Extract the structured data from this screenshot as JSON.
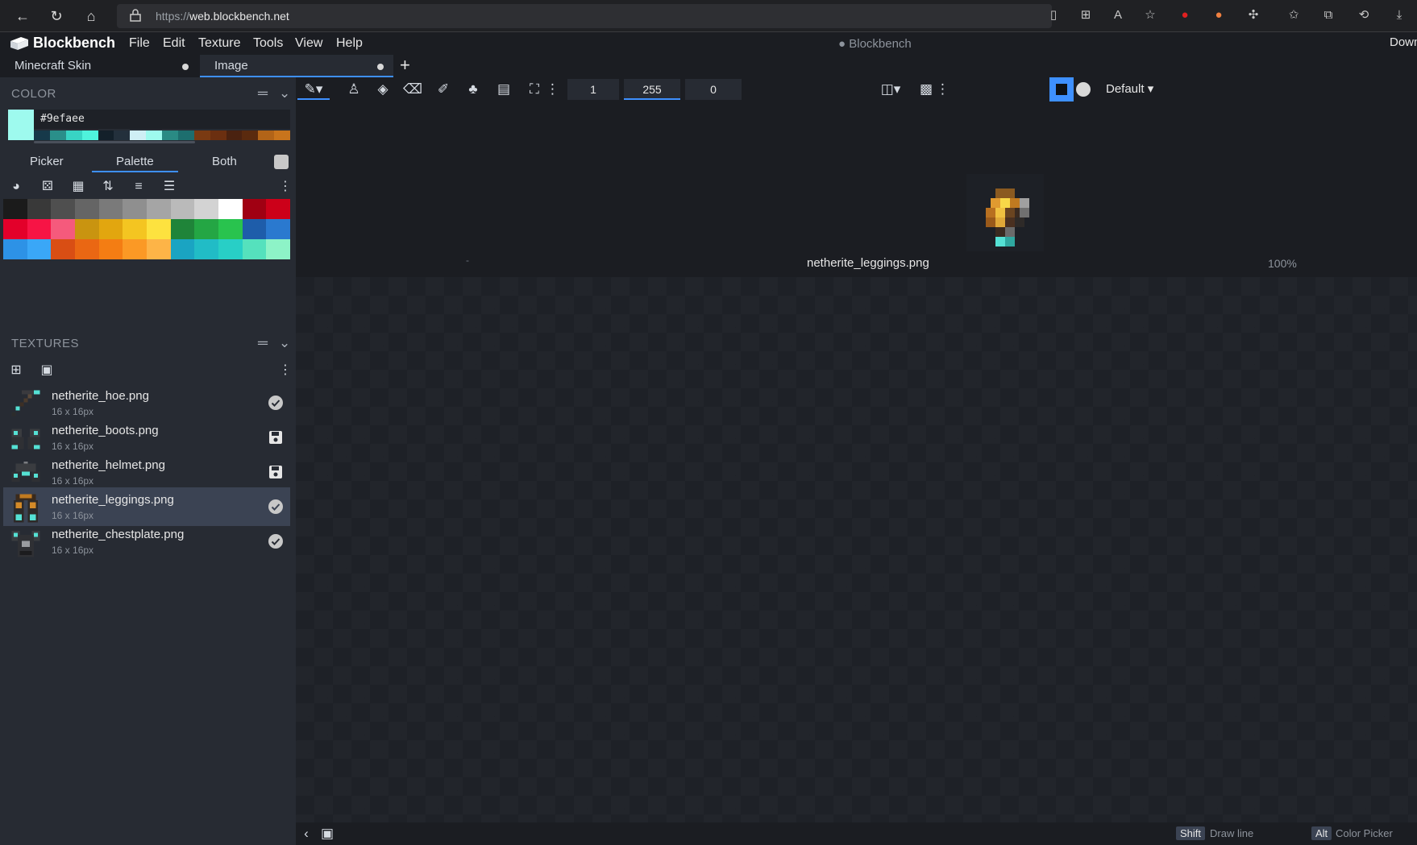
{
  "browser": {
    "url_protocol": "https://",
    "url_host": "web.blockbench.net"
  },
  "app": {
    "name": "Blockbench",
    "menu": [
      "File",
      "Edit",
      "Texture",
      "Tools",
      "View",
      "Help"
    ],
    "window_title": "● Blockbench",
    "download_label": "Down"
  },
  "tabs": [
    {
      "label": "Minecraft Skin"
    },
    {
      "label": "Image"
    }
  ],
  "color_panel": {
    "title": "COLOR",
    "current_hex": "#9efaee",
    "current_color": "#9efaee",
    "history": [
      "#16394a",
      "#2a8f8a",
      "#38d4c4",
      "#4ff2dc",
      "#13202a",
      "#23303c",
      "#cfeff5",
      "#9efaee",
      "#2a8a84",
      "#1d6e6e",
      "#7a3a12",
      "#6b2f10",
      "#4a2210",
      "#5a2a0e",
      "#b26418",
      "#c8741c"
    ],
    "tabs": {
      "picker": "Picker",
      "palette": "Palette",
      "both": "Both"
    },
    "palette": [
      "#1b1b1b",
      "#393939",
      "#4f4f4f",
      "#656565",
      "#7a7a7a",
      "#8f8f8f",
      "#a5a5a5",
      "#bababa",
      "#d3d3d3",
      "#ffffff",
      "#a00012",
      "#cc0019",
      "#e3002a",
      "#f71445",
      "#f55a7c",
      "#c99410",
      "#e2a60f",
      "#f4c521",
      "#fde23f",
      "#1f8439",
      "#24a644",
      "#29c34e",
      "#1e5daa",
      "#2a79cf",
      "#2d92e6",
      "#3aa7f7",
      "#d94e14",
      "#ea6713",
      "#f47d13",
      "#fb9925",
      "#fdb447",
      "#1aa4c2",
      "#21bcc6",
      "#28cfc6",
      "#55e1bd",
      "#8df3c7"
    ]
  },
  "textures_panel": {
    "title": "TEXTURES",
    "items": [
      {
        "name": "netherite_hoe.png",
        "size": "16 x 16px",
        "status": "check-circle-icon"
      },
      {
        "name": "netherite_boots.png",
        "size": "16 x 16px",
        "status": "save-icon"
      },
      {
        "name": "netherite_helmet.png",
        "size": "16 x 16px",
        "status": "save-icon"
      },
      {
        "name": "netherite_leggings.png",
        "size": "16 x 16px",
        "status": "check-circle-icon"
      },
      {
        "name": "netherite_chestplate.png",
        "size": "16 x 16px",
        "status": "check-circle-icon"
      }
    ]
  },
  "toolbar": {
    "brush_size": "1",
    "opacity": "255",
    "softness": "0",
    "blend_mode": "Default"
  },
  "canvas": {
    "filename": "netherite_leggings.png",
    "zoom": "100%",
    "dash": "-"
  },
  "status_bar": {
    "shift_key": "Shift",
    "shift_desc": "Draw line",
    "alt_key": "Alt",
    "alt_desc": "Color Picker"
  }
}
